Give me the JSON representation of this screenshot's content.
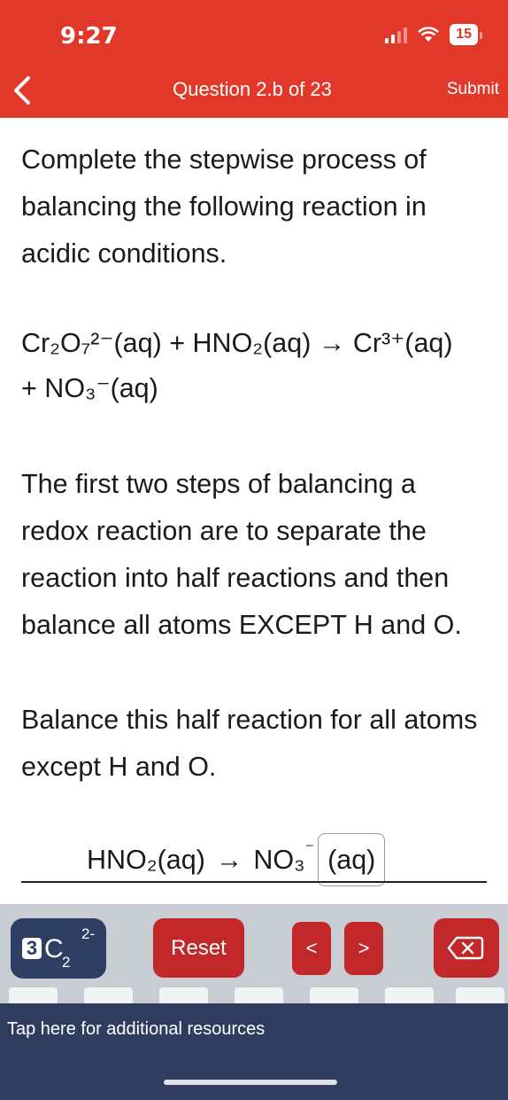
{
  "status": {
    "time": "9:27",
    "battery": "15"
  },
  "header": {
    "title": "Question 2.b of 23",
    "submit_label": "Submit"
  },
  "question": {
    "intro": "Complete the stepwise process of balancing the following reaction in acidic conditions.",
    "equation": {
      "cr2o7": "Cr₂O₇²⁻(aq)",
      "plus1": "+",
      "hno2": "HNO₂(aq)",
      "arrow": "→",
      "cr3": "Cr³⁺(aq)",
      "plus2": "+",
      "no3": "NO₃⁻(aq)"
    },
    "instruction1": "The first two steps of balancing a redox reaction are to separate the reaction into half reactions and then balance all atoms EXCEPT H and O.",
    "instruction2": "Balance this half reaction for all atoms except H and O.",
    "half_reaction": {
      "left": "HNO₂(aq)",
      "arrow": "→",
      "right": "NO₃",
      "right_sup": "⁻",
      "answer_box": "(aq)"
    }
  },
  "keyboard": {
    "key_c": {
      "count": "3",
      "symbol": "C",
      "subscript": "2",
      "superscript": "2-"
    },
    "reset_label": "Reset",
    "prev_label": "<",
    "next_label": ">"
  },
  "resources": {
    "label": "Tap here for additional resources"
  },
  "colors": {
    "header": "#e2382a",
    "key_red": "#c2272a",
    "key_navy": "#2f3f63",
    "resources_bg": "#2e3d5e"
  }
}
